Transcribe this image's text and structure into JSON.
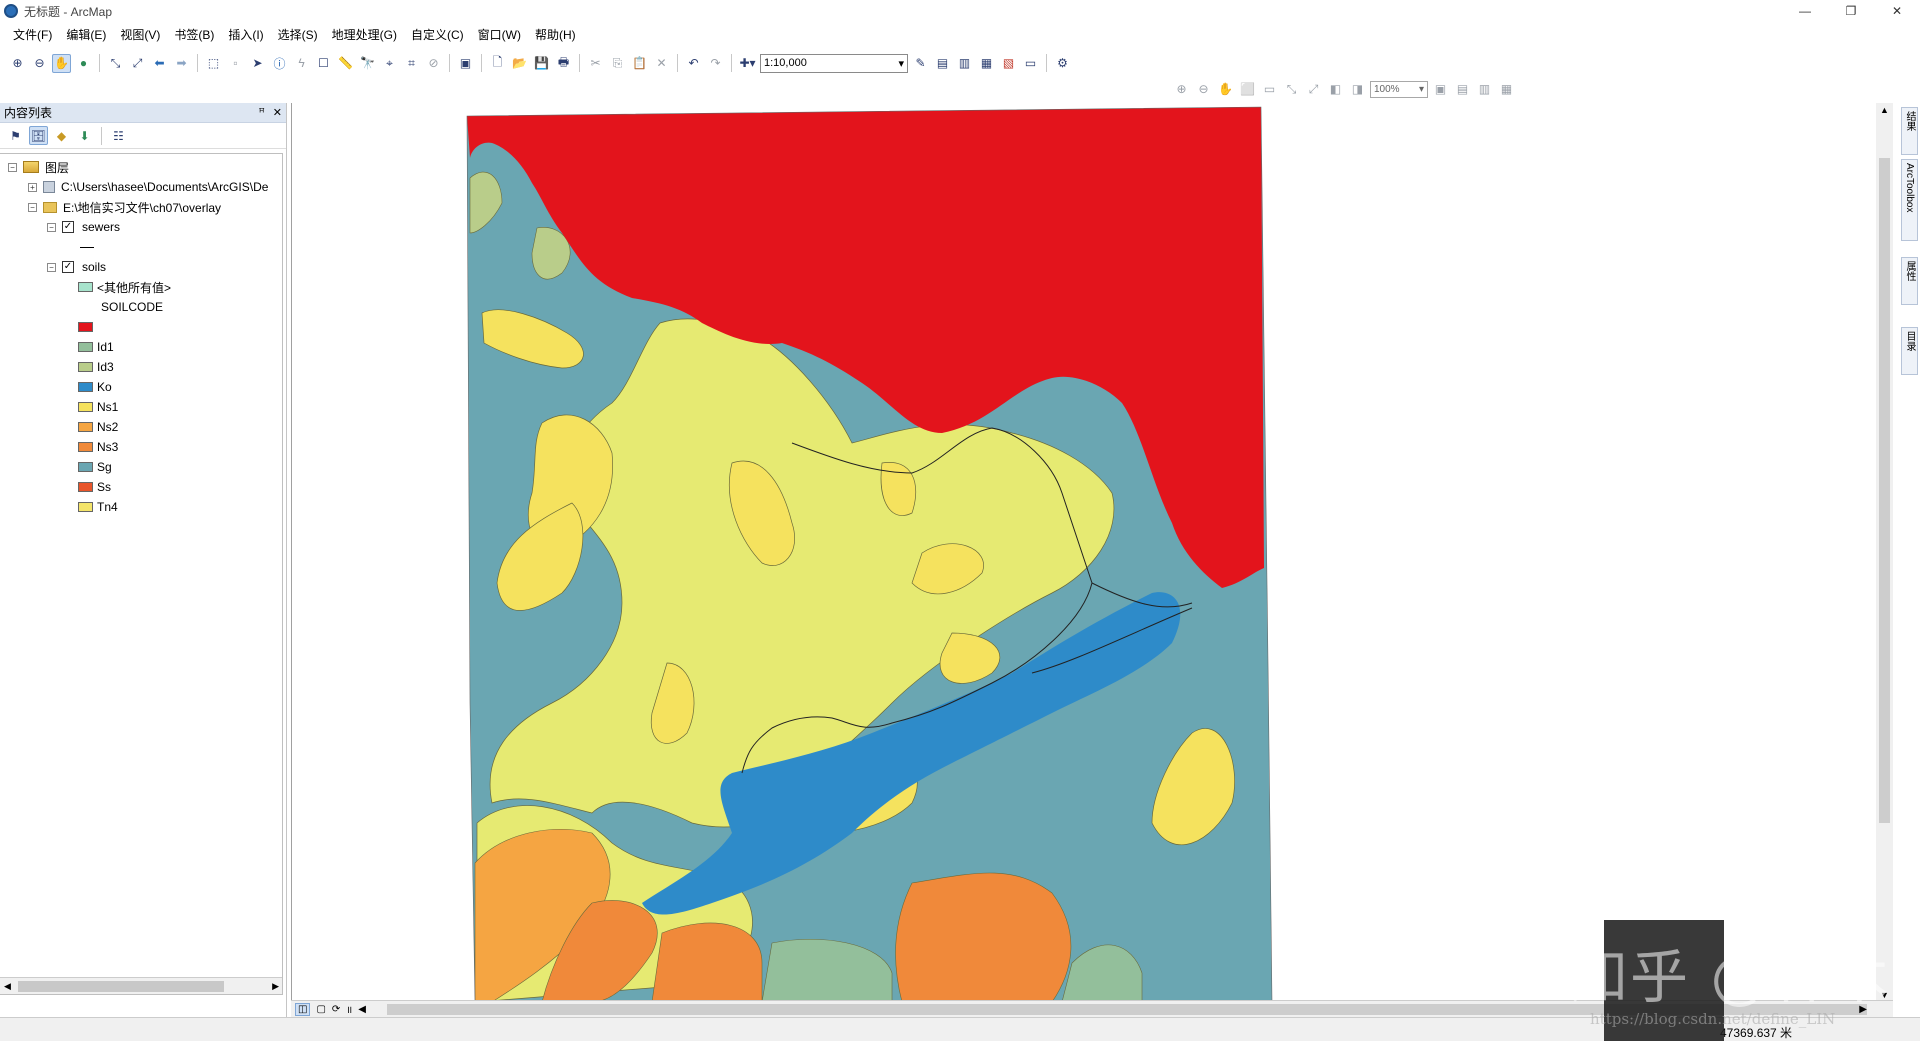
{
  "window": {
    "title": "无标题 - ArcMap",
    "minimize": "—",
    "restore": "❐",
    "close": "✕"
  },
  "menu": [
    "文件(F)",
    "编辑(E)",
    "视图(V)",
    "书签(B)",
    "插入(I)",
    "选择(S)",
    "地理处理(G)",
    "自定义(C)",
    "窗口(W)",
    "帮助(H)"
  ],
  "toolbar": {
    "scale": "1:10,000",
    "zoom_percent": "100%"
  },
  "toc": {
    "title": "内容列表",
    "pin": "ꟸ",
    "close": "✕",
    "root_label": "图层",
    "connection_path": "C:\\Users\\hasee\\Documents\\ArcGIS\\De",
    "folder_path": "E:\\地信实习文件\\ch07\\overlay",
    "layers": {
      "sewers": {
        "name": "sewers",
        "checked": true
      },
      "soils": {
        "name": "soils",
        "checked": true,
        "other_values_label": "<其他所有值>",
        "field_name": "SOILCODE",
        "legend": [
          {
            "label": "",
            "color": "#e3141c"
          },
          {
            "label": "Id1",
            "color": "#93bf9b"
          },
          {
            "label": "Id3",
            "color": "#b9cd8a"
          },
          {
            "label": "Ko",
            "color": "#2e8bc9"
          },
          {
            "label": "Ns1",
            "color": "#f5e25e"
          },
          {
            "label": "Ns2",
            "color": "#f5a542"
          },
          {
            "label": "Ns3",
            "color": "#f08a3a"
          },
          {
            "label": "Sg",
            "color": "#6aa6b2"
          },
          {
            "label": "Ss",
            "color": "#e8552b"
          },
          {
            "label": "Tn4",
            "color": "#f4e46a"
          }
        ],
        "other_values_color": "#a7e3cc"
      }
    }
  },
  "status": {
    "coordinates": "47369.637 米"
  },
  "dock_tabs": [
    "结果",
    "ArcToolbox",
    "属性",
    "目录"
  ],
  "watermark": {
    "brand": "知乎 @林木",
    "url": "https://blog.csdn.net/define_LIN"
  },
  "map_colors": {
    "red": "#e3141c",
    "sg": "#6aa6b2",
    "ns1": "#f5e25e",
    "light_yellow": "#e6ea72",
    "ko": "#2e8bc9",
    "orange": "#f0893a",
    "ns2": "#f5a542",
    "id1": "#93bf9b",
    "id3": "#b9cd8a"
  }
}
